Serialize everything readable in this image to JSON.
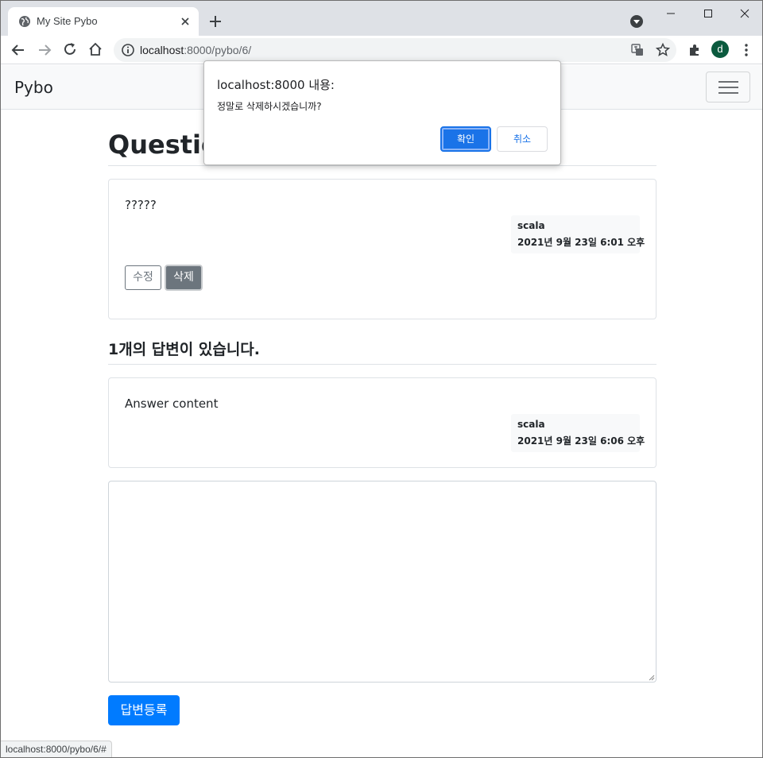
{
  "browser": {
    "tab_title": "My Site Pybo",
    "url_host": "localhost",
    "url_rest": ":8000/pybo/6/",
    "avatar_letter": "d",
    "status_url": "localhost:8000/pybo/6/#"
  },
  "navbar": {
    "brand": "Pybo"
  },
  "question": {
    "title": "Question",
    "content": "?????",
    "author": "scala",
    "date": "2021년 9월 23일 6:01 오후",
    "edit_label": "수정",
    "delete_label": "삭제"
  },
  "answers": {
    "count": "1",
    "count_suffix": "개의 답변이 있습니다.",
    "items": [
      {
        "content": "Answer content",
        "author": "scala",
        "date": "2021년 9월 23일 6:06 오후"
      }
    ]
  },
  "form": {
    "submit_label": "답변등록"
  },
  "dialog": {
    "title": "localhost:8000 내용:",
    "message": "정말로 삭제하시겠습니까?",
    "ok_label": "확인",
    "cancel_label": "취소"
  },
  "colors": {
    "primary": "#007bff",
    "secondary": "#6c757d",
    "dialog_accent": "#1a73e8"
  }
}
